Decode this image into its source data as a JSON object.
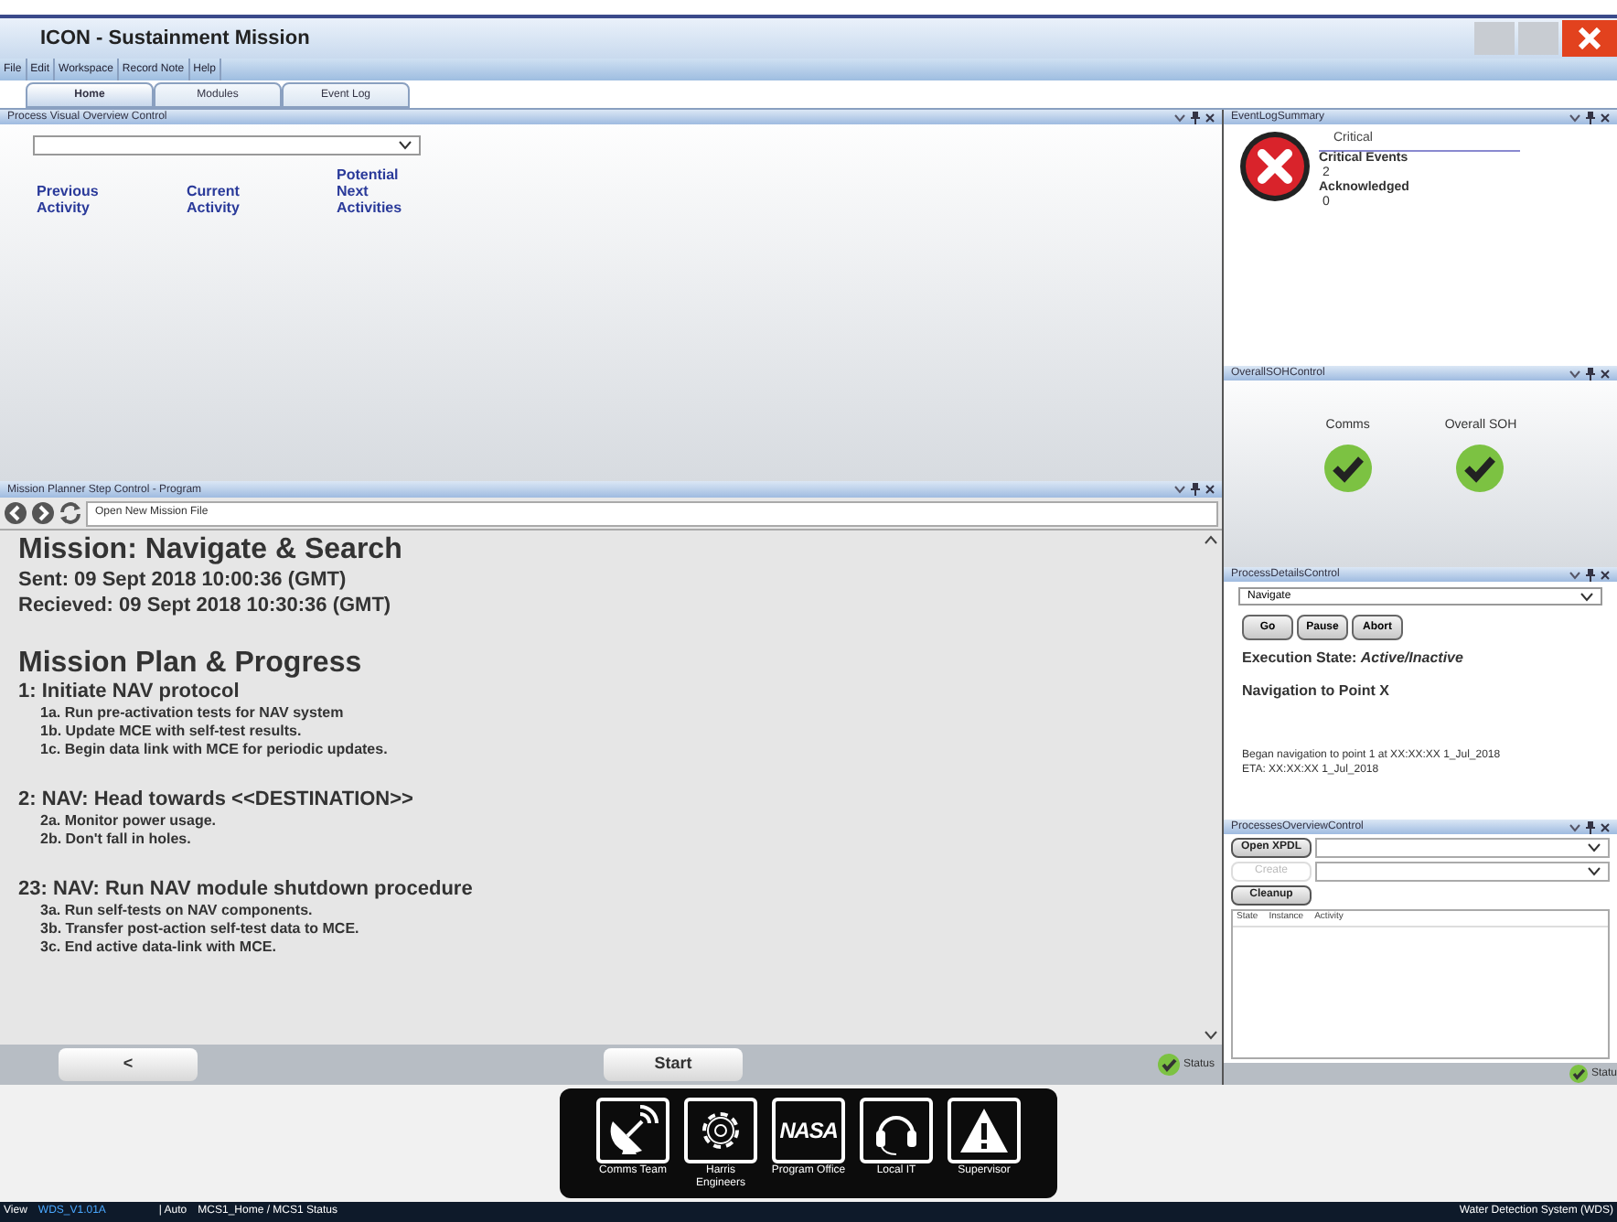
{
  "window": {
    "title": "ICON - Sustainment Mission"
  },
  "menu": [
    "File",
    "Edit",
    "Workspace",
    "Record Note",
    "Help"
  ],
  "tabs": [
    {
      "label": "Home",
      "selected": true
    },
    {
      "label": "Modules",
      "selected": false
    },
    {
      "label": "Event Log",
      "selected": false
    }
  ],
  "process_visual": {
    "title": "Process Visual Overview Control",
    "columns": [
      "Previous Activity",
      "Current Activity",
      "Potential Next Activities"
    ]
  },
  "mission_planner": {
    "title": "Mission Planner Step Control - Program",
    "file_field": "Open New Mission File",
    "mission_title": "Mission: Navigate & Search",
    "sent": "Sent: 09 Sept 2018 10:00:36  (GMT)",
    "received": "Recieved: 09 Sept 2018 10:30:36  (GMT)",
    "plan_title": "Mission Plan & Progress",
    "steps": [
      {
        "heading": "1: Initiate NAV protocol",
        "substeps": [
          "1a. Run pre-activation tests for NAV system",
          "1b. Update MCE with self-test results.",
          "1c. Begin data link with MCE for periodic updates."
        ]
      },
      {
        "heading": "2: NAV: Head towards <<DESTINATION>>",
        "substeps": [
          "2a. Monitor power usage.",
          "2b. Don't fall in holes."
        ]
      },
      {
        "heading": "23: NAV: Run NAV module shutdown procedure",
        "substeps": [
          "3a. Run self-tests on NAV components.",
          "3b. Transfer post-action self-test data to MCE.",
          "3c. End active data-link with MCE."
        ]
      }
    ],
    "back_button": "<",
    "start_button": "Start",
    "status": "Status"
  },
  "event_log": {
    "title": "EventLogSummary",
    "category": "Critical",
    "labels": [
      {
        "label": "Critical Events",
        "value": "2"
      },
      {
        "label": "Acknowledged",
        "value": "0"
      }
    ]
  },
  "soh": {
    "title": "OverallSOHControl",
    "items": [
      {
        "label": "Comms",
        "ok": true
      },
      {
        "label": "Overall SOH",
        "ok": true
      }
    ]
  },
  "process_details": {
    "title": "ProcessDetailsControl",
    "selection": "Navigate",
    "buttons": [
      "Go",
      "Pause",
      "Abort"
    ],
    "state_label": "Execution State: ",
    "state_value": "Active/Inactive",
    "step": "Navigation to Point X",
    "log": [
      "Began navigation to point 1 at XX:XX:XX 1_Jul_2018",
      "ETA: XX:XX:XX 1_Jul_2018"
    ]
  },
  "processes_overview": {
    "title": "ProcessesOverviewControl",
    "buttons": [
      {
        "label": "Open XPDL",
        "disabled": false
      },
      {
        "label": "Create",
        "disabled": true
      },
      {
        "label": "Cleanup",
        "disabled": false
      }
    ],
    "columns": [
      "State",
      "Instance",
      "Activity"
    ],
    "status": "Statu"
  },
  "dock": [
    {
      "kind": "dish",
      "label": "Comms Team"
    },
    {
      "kind": "gear",
      "label": "Harris Engineers"
    },
    {
      "kind": "logo",
      "logo_text": "NASA",
      "label": "Program Office"
    },
    {
      "kind": "headset",
      "label": "Local IT"
    },
    {
      "kind": "warning",
      "label": "Supervisor"
    }
  ],
  "status_strip": {
    "view": "View",
    "version": "WDS_V1.01A",
    "mode": "| Auto",
    "path": "MCS1_Home / MCS1 Status",
    "system": "Water Detection System (WDS)"
  }
}
